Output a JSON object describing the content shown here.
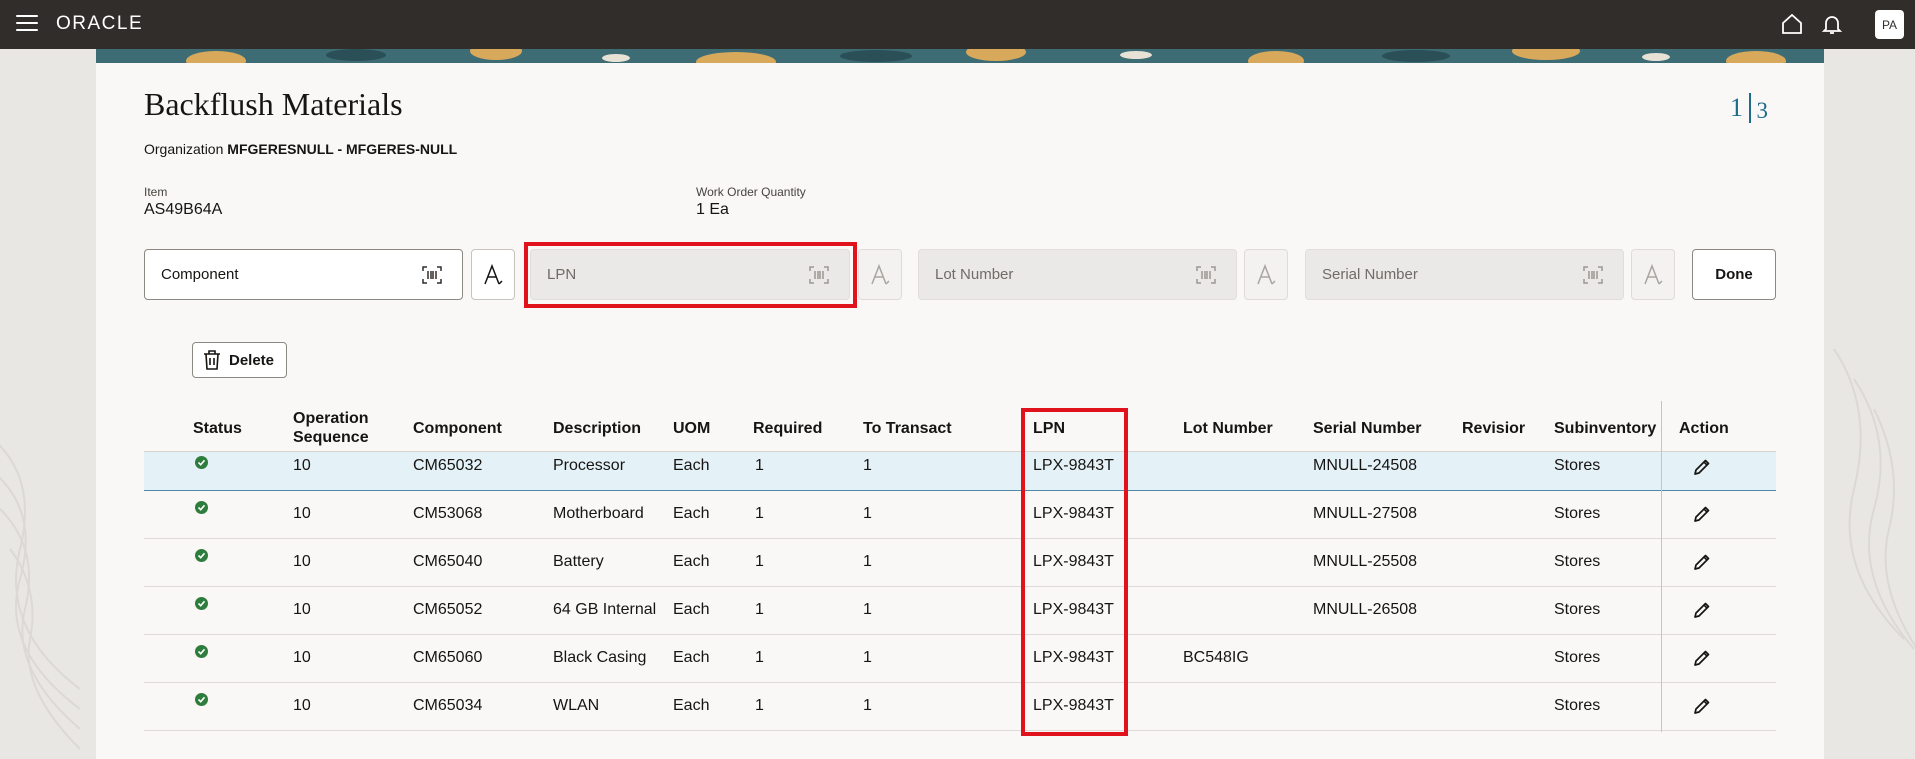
{
  "header": {
    "brand": "ORACLE",
    "avatar_initials": "PA"
  },
  "page": {
    "title": "Backflush Materials",
    "org_label": "Organization",
    "org_value": "MFGERESNULL - MFGERES-NULL",
    "page_current": "1",
    "page_total": "3"
  },
  "fields": {
    "item_label": "Item",
    "item_value": "AS49B64A",
    "woq_label": "Work Order Quantity",
    "woq_value": "1 Ea"
  },
  "scan": {
    "component": "Component",
    "lpn": "LPN",
    "lot": "Lot Number",
    "serial": "Serial Number",
    "done": "Done"
  },
  "toolbar": {
    "delete_label": "Delete"
  },
  "table": {
    "headers": {
      "status": "Status",
      "op_seq_1": "Operation",
      "op_seq_2": "Sequence",
      "component": "Component",
      "description": "Description",
      "uom": "UOM",
      "required": "Required",
      "to_transact": "To Transact",
      "lpn": "LPN",
      "lot": "Lot Number",
      "serial": "Serial Number",
      "revision": "Revisior",
      "subinventory": "Subinventory",
      "action": "Action"
    },
    "rows": [
      {
        "op": "10",
        "component": "CM65032",
        "description": "Processor",
        "uom": "Each",
        "required": "1",
        "to_transact": "1",
        "lpn": "LPX-9843T",
        "lot": "",
        "serial": "MNULL-24508",
        "revision": "",
        "subinventory": "Stores"
      },
      {
        "op": "10",
        "component": "CM53068",
        "description": "Motherboard",
        "uom": "Each",
        "required": "1",
        "to_transact": "1",
        "lpn": "LPX-9843T",
        "lot": "",
        "serial": "MNULL-27508",
        "revision": "",
        "subinventory": "Stores"
      },
      {
        "op": "10",
        "component": "CM65040",
        "description": "Battery",
        "uom": "Each",
        "required": "1",
        "to_transact": "1",
        "lpn": "LPX-9843T",
        "lot": "",
        "serial": "MNULL-25508",
        "revision": "",
        "subinventory": "Stores"
      },
      {
        "op": "10",
        "component": "CM65052",
        "description": "64 GB Internal",
        "uom": "Each",
        "required": "1",
        "to_transact": "1",
        "lpn": "LPX-9843T",
        "lot": "",
        "serial": "MNULL-26508",
        "revision": "",
        "subinventory": "Stores"
      },
      {
        "op": "10",
        "component": "CM65060",
        "description": "Black Casing",
        "uom": "Each",
        "required": "1",
        "to_transact": "1",
        "lpn": "LPX-9843T",
        "lot": "BC548IG",
        "serial": "",
        "revision": "",
        "subinventory": "Stores"
      },
      {
        "op": "10",
        "component": "CM65034",
        "description": "WLAN",
        "uom": "Each",
        "required": "1",
        "to_transact": "1",
        "lpn": "LPX-9843T",
        "lot": "",
        "serial": "",
        "revision": "",
        "subinventory": "Stores"
      }
    ]
  },
  "colors": {
    "topbar": "#312d2a",
    "highlight": "#e0121c",
    "status_ok": "#2e7d3d",
    "selected_row": "#e4f1f7",
    "page_counter": "#1f6b8a"
  }
}
